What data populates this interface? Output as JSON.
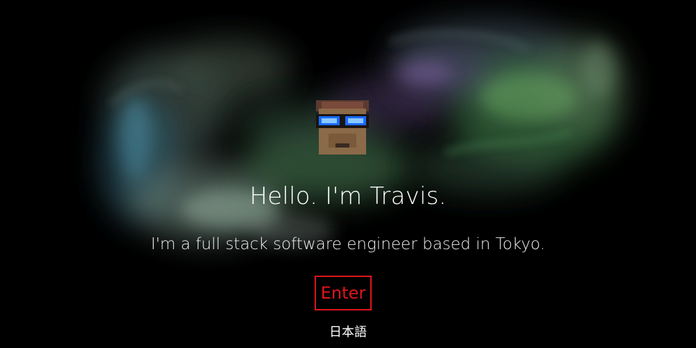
{
  "hero": {
    "headline": "Hello. I'm Travis.",
    "subline": "I'm a full stack software engineer based in Tokyo.",
    "enter_label": "Enter",
    "language_label": "日本語"
  },
  "colors": {
    "background": "#000000",
    "text": "#ffffff",
    "accent": "#e0151b",
    "smoke_green": "#5f9a63",
    "smoke_purple": "#6a4a8a",
    "smoke_teal": "#4a7a86"
  },
  "icons": {
    "avatar": "voxel-head-with-glowing-glasses-icon"
  }
}
